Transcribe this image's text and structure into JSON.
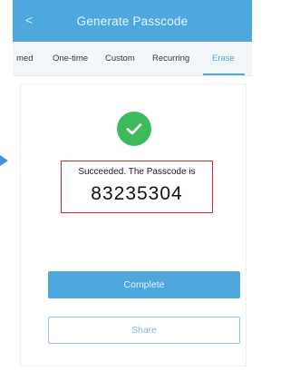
{
  "header": {
    "back_icon": "chevron-left-icon",
    "back_glyph": "<",
    "title": "Generate Passcode",
    "color": "#4ea8de"
  },
  "tabs": [
    {
      "label": "med",
      "active": false
    },
    {
      "label": "One-time",
      "active": false
    },
    {
      "label": "Custom",
      "active": false
    },
    {
      "label": "Recurring",
      "active": false
    },
    {
      "label": "Erase",
      "active": true
    }
  ],
  "result": {
    "icon": "success-check-icon",
    "message": "Succeeded. The Passcode is",
    "passcode": "83235304",
    "highlight_color": "#d42a2a"
  },
  "buttons": {
    "complete_label": "Complete",
    "share_label": "Share"
  },
  "colors": {
    "accent": "#4ea8de",
    "success": "#3dbb5c"
  }
}
